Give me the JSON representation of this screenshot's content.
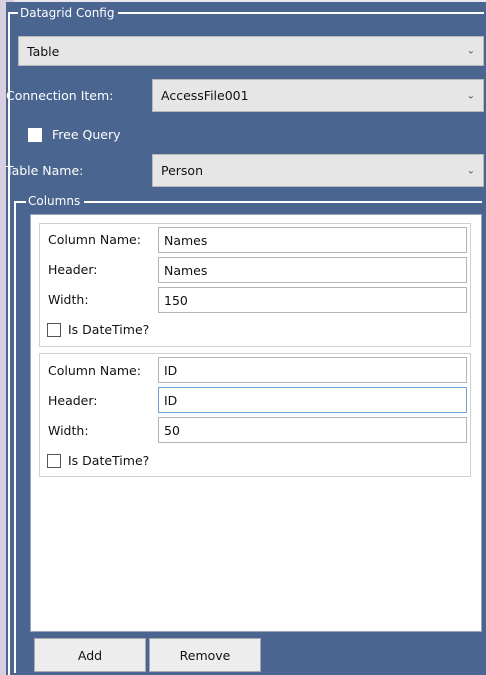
{
  "config": {
    "group_title": "Datagrid Config",
    "source_type": "Table",
    "connection_label": "Connection Item:",
    "connection_value": "AccessFile001",
    "free_query_label": "Free Query",
    "table_name_label": "Table Name:",
    "table_name_value": "Person"
  },
  "columns": {
    "title": "Columns",
    "items": [
      {
        "column_name_label": "Column Name:",
        "column_name": "Names",
        "header_label": "Header:",
        "header": "Names",
        "width_label": "Width:",
        "width": "150",
        "is_datetime_label": "Is DateTime?"
      },
      {
        "column_name_label": "Column Name:",
        "column_name": "ID",
        "header_label": "Header:",
        "header": "ID",
        "width_label": "Width:",
        "width": "50",
        "is_datetime_label": "Is DateTime?"
      }
    ]
  },
  "buttons": {
    "add": "Add",
    "remove": "Remove"
  }
}
